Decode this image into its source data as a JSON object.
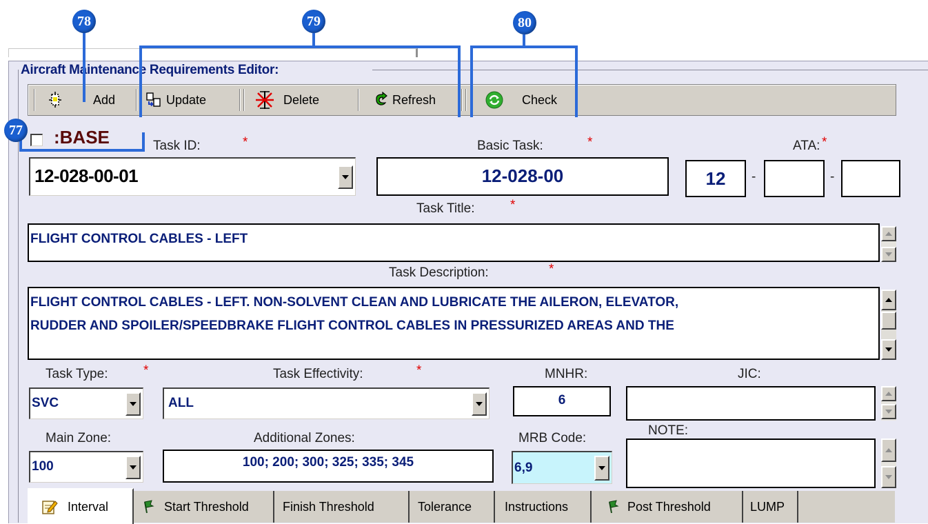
{
  "window": {
    "title": "Aircraft Maintenance Requirements Editor:"
  },
  "callouts": [
    "78",
    "79",
    "80",
    "77"
  ],
  "toolbar": {
    "add_label": "Add",
    "update_label": "Update",
    "delete_label": "Delete",
    "refresh_label": "Refresh",
    "check_label": "Check"
  },
  "form": {
    "base_label": ":BASE",
    "base_checked": false,
    "task_id_label": "Task ID:",
    "task_id_value": "12-028-00-01",
    "basic_task_label": "Basic Task:",
    "basic_task_value": "12-028-00",
    "ata_label": "ATA:",
    "ata_1": "12",
    "ata_2": "",
    "ata_3": "",
    "ata_sep": "-",
    "task_title_label": "Task Title:",
    "task_title_value": "FLIGHT CONTROL CABLES - LEFT",
    "task_description_label": "Task Description:",
    "task_description_line1": "FLIGHT CONTROL CABLES - LEFT. NON-SOLVENT CLEAN AND LUBRICATE THE AILERON, ELEVATOR,",
    "task_description_line2": "RUDDER AND SPOILER/SPEEDBRAKE FLIGHT CONTROL CABLES IN PRESSURIZED AREAS AND THE",
    "task_type_label": "Task Type:",
    "task_type_value": "SVC",
    "task_effectivity_label": "Task Effectivity:",
    "task_effectivity_value": "ALL",
    "mnhr_label": "MNHR:",
    "mnhr_value": "6",
    "jic_label": "JIC:",
    "jic_value": "",
    "main_zone_label": "Main Zone:",
    "main_zone_value": "100",
    "additional_zones_label": "Additional Zones:",
    "additional_zones_value": "100; 200; 300; 325; 335; 345",
    "mrb_code_label": "MRB Code:",
    "mrb_code_value": "6,9",
    "note_label": "NOTE:",
    "note_value": "",
    "required_mark": "*"
  },
  "tabs": [
    "Interval",
    "Start Threshold",
    "Finish Threshold",
    "Tolerance",
    "Instructions",
    "Post Threshold",
    "LUMP"
  ],
  "colors": {
    "value_text": "#0a1e78",
    "required": "#e00000",
    "callout": "#1a5fd0",
    "mrb_highlight": "#c8f4fc",
    "panel": "#e8e8f4"
  }
}
